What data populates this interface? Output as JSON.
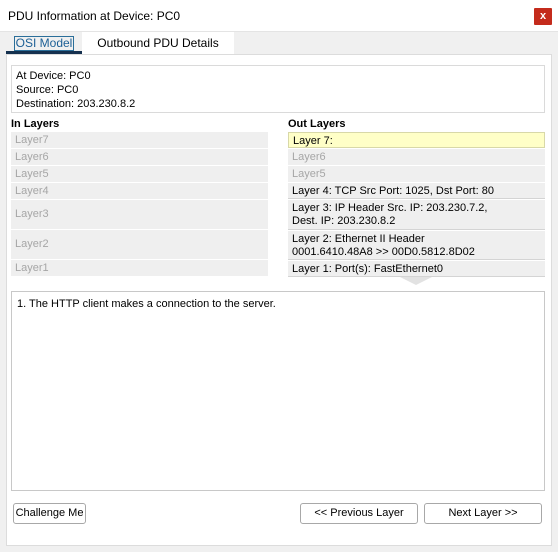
{
  "window": {
    "title": "PDU Information at Device: PC0",
    "close_label": "x"
  },
  "tabs": [
    {
      "label": "OSI Model",
      "selected": true
    },
    {
      "label": "Outbound PDU Details",
      "selected": false
    }
  ],
  "device_info": {
    "device": "At Device: PC0",
    "source": "Source: PC0",
    "destination": "Destination: 203.230.8.2"
  },
  "in_layers": {
    "header": "In Layers",
    "items": [
      "Layer7",
      "Layer6",
      "Layer5",
      "Layer4",
      "Layer3",
      "Layer2",
      "Layer1"
    ]
  },
  "out_layers": {
    "header": "Out Layers",
    "items": [
      {
        "lines": [
          "Layer 7:"
        ],
        "state": "active"
      },
      {
        "lines": [
          "Layer6"
        ],
        "state": "inactive"
      },
      {
        "lines": [
          "Layer5"
        ],
        "state": "inactive"
      },
      {
        "lines": [
          "Layer 4: TCP Src Port: 1025, Dst Port: 80"
        ],
        "state": "normal"
      },
      {
        "lines": [
          "Layer 3: IP Header Src. IP: 203.230.7.2,",
          "Dest. IP: 203.230.8.2"
        ],
        "state": "normal"
      },
      {
        "lines": [
          "Layer 2: Ethernet II Header",
          "0001.6410.48A8 >> 00D0.5812.8D02"
        ],
        "state": "normal"
      },
      {
        "lines": [
          "Layer 1: Port(s): FastEthernet0"
        ],
        "state": "normal"
      }
    ]
  },
  "description": "1. The HTTP client makes a connection to the server.",
  "buttons": {
    "challenge": "Challenge Me",
    "previous": "<< Previous Layer",
    "next": "Next Layer >>"
  },
  "colors": {
    "active_layer_bg": "#ffffc7",
    "close_button": "#c42b1c",
    "tab_underline": "#15314f"
  }
}
